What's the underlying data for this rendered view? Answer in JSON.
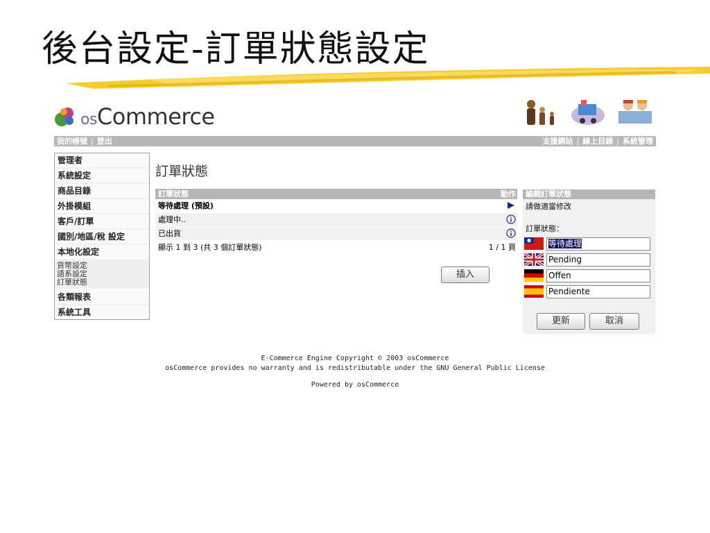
{
  "slide": {
    "title": "後台設定-訂單狀態設定"
  },
  "header": {
    "logo_prefix": "os",
    "logo_main": "Commerce",
    "left_links": [
      "我的帳號",
      "登出"
    ],
    "right_links": [
      "支援網站",
      "線上目錄",
      "系統管理"
    ],
    "separator": "|"
  },
  "sidebar": {
    "items": [
      {
        "label": "管理者"
      },
      {
        "label": "系統設定"
      },
      {
        "label": "商品目錄"
      },
      {
        "label": "外掛模組"
      },
      {
        "label": "客戶/訂單"
      },
      {
        "label": "國別/地區/稅 設定"
      },
      {
        "label": "本地化設定",
        "sub": [
          "貨幣設定",
          "語系設定",
          "訂單狀態"
        ]
      },
      {
        "label": "各類報表"
      },
      {
        "label": "系統工具"
      }
    ]
  },
  "main": {
    "title": "訂單狀態",
    "columns": {
      "status": "訂單狀態",
      "action": "動作"
    },
    "rows": [
      {
        "label": "等待處理 (預設)",
        "selected": true,
        "action_icon": "arrow-right-icon"
      },
      {
        "label": "處理中..",
        "selected": false,
        "action_icon": "info-icon"
      },
      {
        "label": "已出貨",
        "selected": false,
        "action_icon": "info-icon"
      }
    ],
    "summary": "顯示 1 到 3 (共 3 個訂單狀態)",
    "pagination": "1 / 1 頁",
    "insert_button": "插入"
  },
  "edit_panel": {
    "title": "編輯訂單狀態",
    "hint": "請做適當修改",
    "field_label": "訂單狀態：",
    "languages": [
      {
        "flag": "taiwan-flag-icon",
        "value": "等待處理"
      },
      {
        "flag": "uk-flag-icon",
        "value": "Pending"
      },
      {
        "flag": "germany-flag-icon",
        "value": "Offen"
      },
      {
        "flag": "spain-flag-icon",
        "value": "Pendiente"
      }
    ],
    "update_button": "更新",
    "cancel_button": "取消"
  },
  "footer": {
    "line1": "E-Commerce Engine Copyright © 2003 osCommerce",
    "line2": "osCommerce provides no warranty and is redistributable under the GNU General Public License",
    "line3": "Powered by osCommerce"
  }
}
